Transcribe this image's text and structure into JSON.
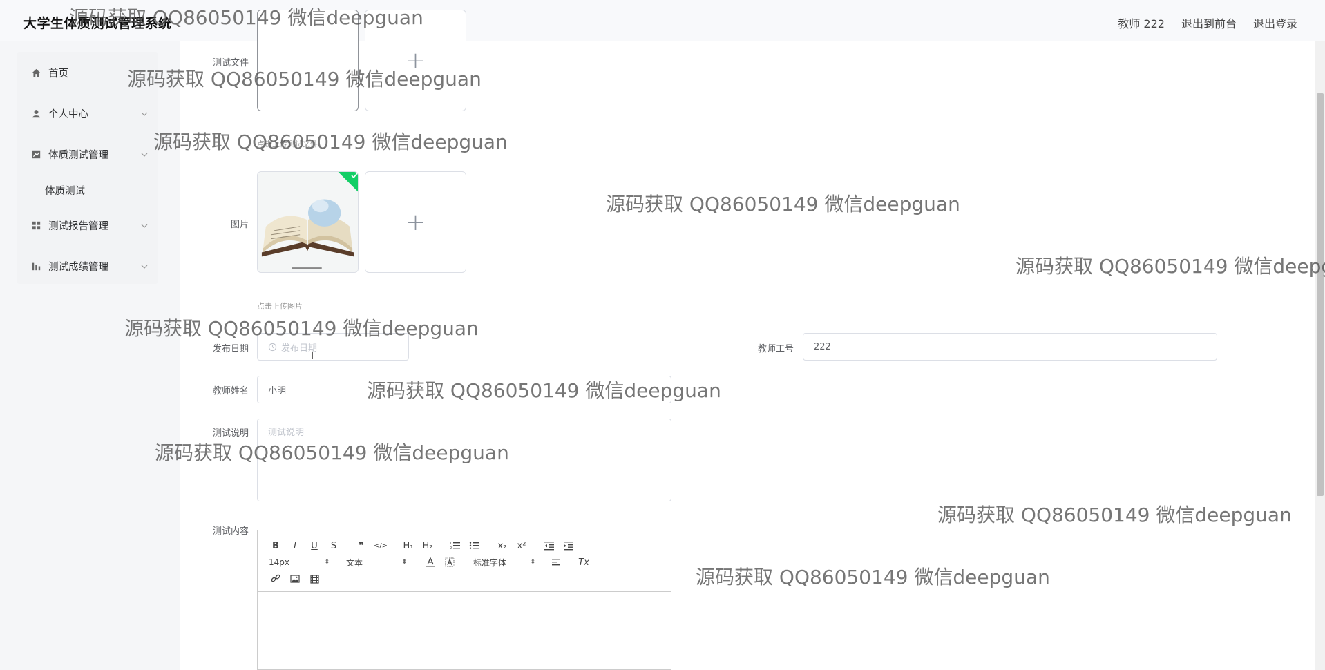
{
  "app": {
    "title": "大学生体质测试管理系统"
  },
  "header": {
    "user": "教师 222",
    "front_link": "退出到前台",
    "logout_link": "退出登录"
  },
  "sidebar": {
    "items": [
      {
        "label": "首页",
        "icon": "home-icon"
      },
      {
        "label": "个人中心",
        "icon": "user-icon"
      },
      {
        "label": "体质测试管理",
        "icon": "chart-icon"
      },
      {
        "label": "体质测试",
        "sub": true
      },
      {
        "label": "测试报告管理",
        "icon": "grid-icon"
      },
      {
        "label": "测试成绩管理",
        "icon": "bars-icon"
      }
    ]
  },
  "form": {
    "test_file_label": "测试文件",
    "test_file_tip": "点击上传测试文件",
    "image_label": "图片",
    "image_tip": "点击上传图片",
    "publish_date_label": "发布日期",
    "publish_date_placeholder": "发布日期",
    "teacher_id_label": "教师工号",
    "teacher_id_value": "222",
    "teacher_name_label": "教师姓名",
    "teacher_name_value": "小明",
    "description_label": "测试说明",
    "description_placeholder": "测试说明",
    "content_label": "测试内容"
  },
  "editor": {
    "size_value": "14px",
    "header_value": "文本",
    "font_value": "标准字体",
    "buttons": {
      "bold": "B",
      "italic": "I",
      "underline": "U",
      "strike": "S",
      "quote": "❞",
      "code": "</>",
      "h1": "H₁",
      "h2": "H₂",
      "sub": "x₂",
      "sup": "x²",
      "clean": "Tx"
    }
  },
  "watermark": "源码获取 QQ86050149 微信deepguan"
}
